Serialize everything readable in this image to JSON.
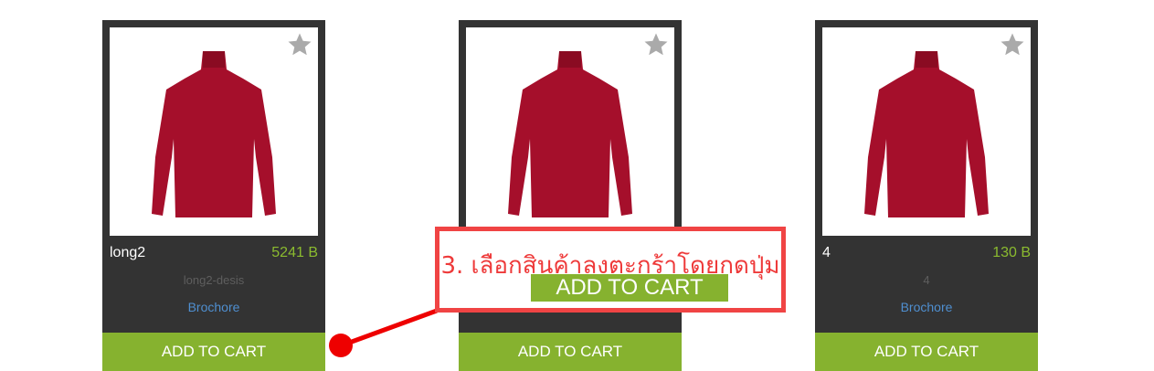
{
  "products": [
    {
      "name": "long2",
      "price": "5241 B",
      "description": "long2-desis",
      "brochure": "Brochore",
      "add_label": "ADD TO CART"
    },
    {
      "name": "",
      "price": "",
      "description": "",
      "brochure": "",
      "add_label": "ADD TO CART"
    },
    {
      "name": "4",
      "price": "130 B",
      "description": "4",
      "brochure": "Brochore",
      "add_label": "ADD TO CART"
    }
  ],
  "callout": {
    "text": "3. เลือกสินค้าลงตะกร้าโดยกดปุ่ม",
    "button_label": "ADD TO CART"
  },
  "icons": {
    "favorite": "star-icon",
    "product_image": "turtleneck-shirt"
  },
  "colors": {
    "card_bg": "#333333",
    "accent_green": "#86b22f",
    "price_green": "#8bbb2f",
    "link_blue": "#4f8fd0",
    "callout_red": "#f04444",
    "shirt_red": "#a50f2b"
  }
}
